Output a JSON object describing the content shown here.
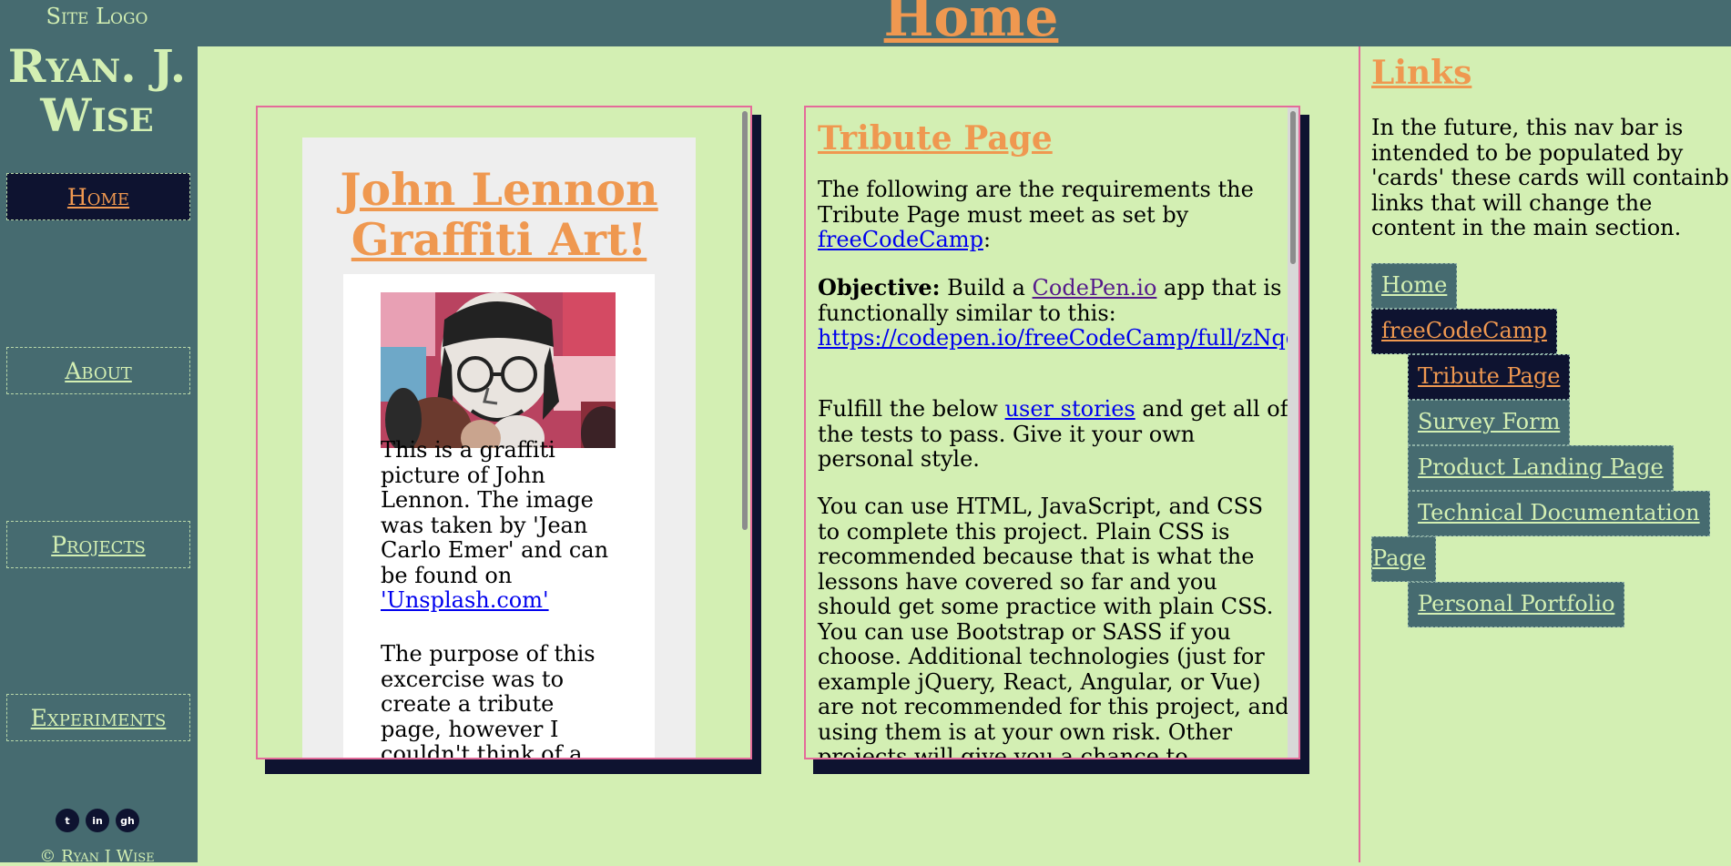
{
  "header": {
    "title": "Home"
  },
  "sidebar": {
    "site_logo": "Site Logo",
    "site_name": "Ryan. J. Wise",
    "nav": [
      {
        "label": "Home",
        "active": true
      },
      {
        "label": "About",
        "active": false
      },
      {
        "label": "Projects",
        "active": false
      },
      {
        "label": "Experiments",
        "active": false
      }
    ],
    "socials": [
      {
        "icon": "twitter-icon",
        "glyph": "t"
      },
      {
        "icon": "linkedin-icon",
        "glyph": "in"
      },
      {
        "icon": "github-icon",
        "glyph": "gh"
      }
    ],
    "copyright": "© Ryan J Wise"
  },
  "card_lennon": {
    "title": "John Lennon Graffiti Art!",
    "paragraph1_pre": "This is a graffiti picture of John Lennon. The image was taken by 'Jean Carlo Emer' and can be found on ",
    "paragraph1_link": "'Unsplash.com'",
    "paragraph2": "The purpose of this excercise was to create a tribute page, however I couldn't think of a"
  },
  "card_tribute": {
    "title": "Tribute Page",
    "p1_pre": "The following are the requirements the Tribute Page must meet as set by ",
    "p1_link": "freeCodeCamp",
    "p1_post": ":",
    "p2_bold": "Objective:",
    "p2_pre": " Build a ",
    "p2_link": "CodePen.io",
    "p2_mid": " app that is functionally similar to this: ",
    "p2_url": "https://codepen.io/freeCodeCamp/full/zNqgVx",
    "p2_post": ".",
    "p3_pre": "Fulfill the below ",
    "p3_link": "user stories",
    "p3_post": " and get all of the tests to pass. Give it your own personal style.",
    "p4": "You can use HTML, JavaScript, and CSS to complete this project. Plain CSS is recommended because that is what the lessons have covered so far and you should get some practice with plain CSS. You can use Bootstrap or SASS if you choose. Additional technologies (just for example jQuery, React, Angular, or Vue) are not recommended for this project, and using them is at your own risk. Other projects will give you a chance to"
  },
  "links": {
    "title": "Links",
    "intro": "In the future, this nav bar is intended to be populated by 'cards' these cards will containb links that will change the content in the main section.",
    "items": [
      {
        "label": "Home",
        "active": false
      },
      {
        "label": "freeCodeCamp",
        "active": true
      },
      {
        "label": "Tribute Page",
        "active": true
      },
      {
        "label": "Survey Form",
        "active": false
      },
      {
        "label": "Product Landing Page",
        "active": false
      },
      {
        "label": "Technical Documentation",
        "active": false
      },
      {
        "label": "Page",
        "active": false
      },
      {
        "label": "Personal Portfolio",
        "active": false
      }
    ]
  },
  "colors": {
    "header_bg": "#466b70",
    "page_bg": "#d3efb3",
    "accent": "#ef9850",
    "dark": "#0e1330",
    "card_border": "#e46b9a"
  }
}
